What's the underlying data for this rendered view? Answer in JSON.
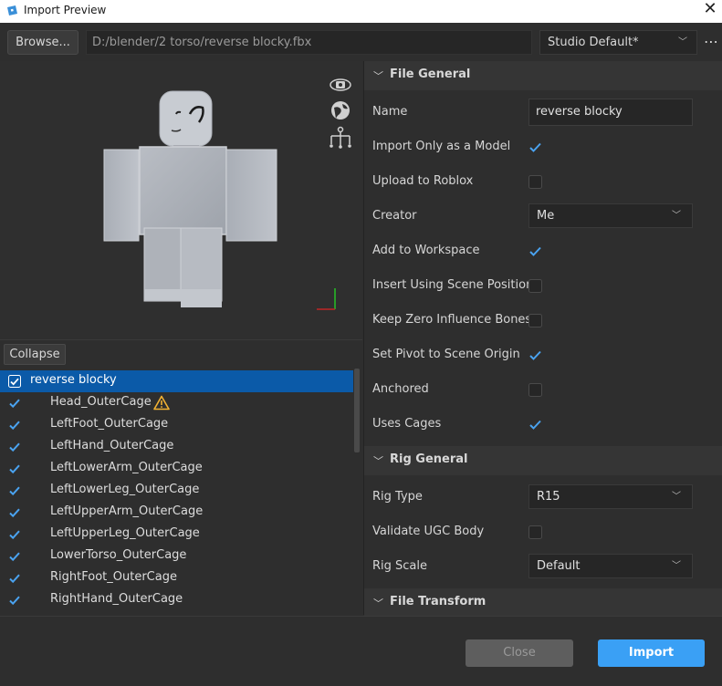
{
  "window": {
    "title": "Import Preview"
  },
  "toolbar": {
    "browse_label": "Browse...",
    "file_path": "D:/blender/2 torso/reverse blocky.fbx",
    "preset": "Studio Default*"
  },
  "viewport": {
    "icons": [
      "rotate-camera-icon",
      "globe-icon",
      "rig-icon"
    ]
  },
  "tree": {
    "collapse_label": "Collapse",
    "items": [
      {
        "label": "reverse blocky",
        "checked": true,
        "selected": true,
        "warning": false
      },
      {
        "label": "Head_OuterCage",
        "checked": true,
        "selected": false,
        "warning": true
      },
      {
        "label": "LeftFoot_OuterCage",
        "checked": true,
        "selected": false,
        "warning": false
      },
      {
        "label": "LeftHand_OuterCage",
        "checked": true,
        "selected": false,
        "warning": false
      },
      {
        "label": "LeftLowerArm_OuterCage",
        "checked": true,
        "selected": false,
        "warning": false
      },
      {
        "label": "LeftLowerLeg_OuterCage",
        "checked": true,
        "selected": false,
        "warning": false
      },
      {
        "label": "LeftUpperArm_OuterCage",
        "checked": true,
        "selected": false,
        "warning": false
      },
      {
        "label": "LeftUpperLeg_OuterCage",
        "checked": true,
        "selected": false,
        "warning": false
      },
      {
        "label": "LowerTorso_OuterCage",
        "checked": true,
        "selected": false,
        "warning": false
      },
      {
        "label": "RightFoot_OuterCage",
        "checked": true,
        "selected": false,
        "warning": false
      },
      {
        "label": "RightHand_OuterCage",
        "checked": true,
        "selected": false,
        "warning": false
      }
    ]
  },
  "sections": {
    "file_general": "File General",
    "rig_general": "Rig General",
    "file_transform": "File Transform"
  },
  "props": {
    "name": {
      "label": "Name",
      "value": "reverse blocky"
    },
    "import_only_model": {
      "label": "Import Only as a Model",
      "checked": true
    },
    "upload_to_roblox": {
      "label": "Upload to Roblox",
      "checked": false
    },
    "creator": {
      "label": "Creator",
      "value": "Me"
    },
    "add_to_workspace": {
      "label": "Add to Workspace",
      "checked": true
    },
    "insert_scene_position": {
      "label": "Insert Using Scene Position",
      "checked": false
    },
    "keep_zero_influence": {
      "label": "Keep Zero Influence Bones",
      "checked": false
    },
    "set_pivot": {
      "label": "Set Pivot to Scene Origin",
      "checked": true
    },
    "anchored": {
      "label": "Anchored",
      "checked": false
    },
    "uses_cages": {
      "label": "Uses Cages",
      "checked": true
    },
    "rig_type": {
      "label": "Rig Type",
      "value": "R15"
    },
    "validate_ugc": {
      "label": "Validate UGC Body",
      "checked": false
    },
    "rig_scale": {
      "label": "Rig Scale",
      "value": "Default"
    }
  },
  "footer": {
    "close_label": "Close",
    "import_label": "Import"
  },
  "colors": {
    "accent": "#3aa0f5",
    "selection": "#0b5aa8",
    "check": "#4aa3f0"
  }
}
